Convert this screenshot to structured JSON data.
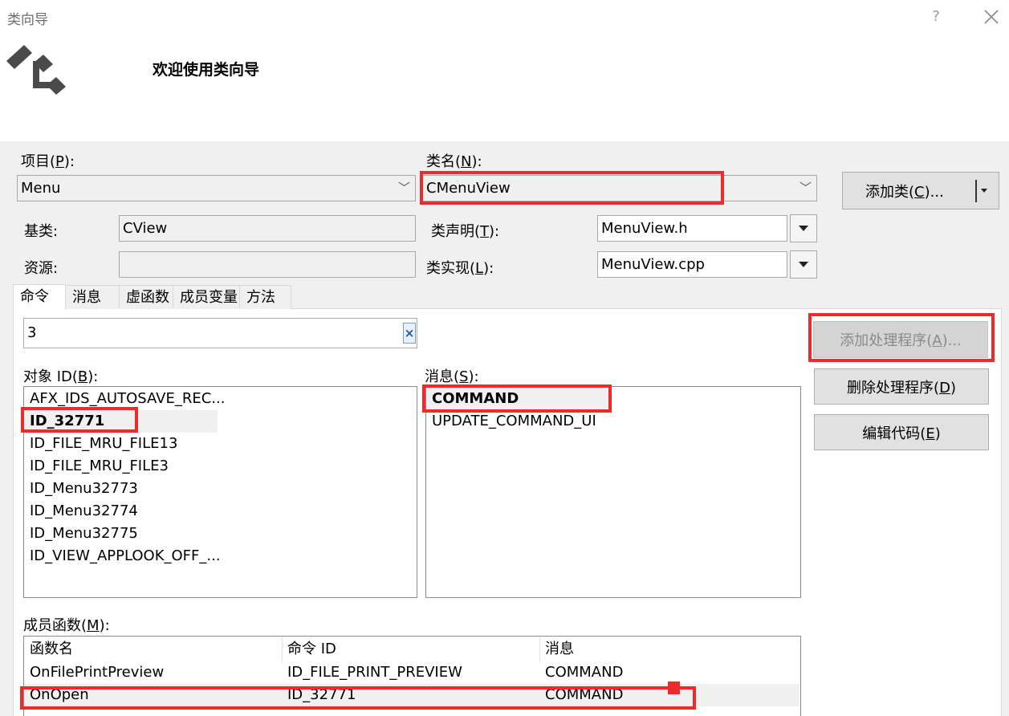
{
  "window": {
    "title": "类向导",
    "help_label": "?",
    "heading": "欢迎使用类向导"
  },
  "fields": {
    "project_label": "项目(",
    "project_key": "P",
    "project_value": "Menu",
    "classname_label": "类名(",
    "classname_key": "N",
    "classname_value": "CMenuView",
    "baseclass_label": "基类:",
    "baseclass_value": "CView",
    "resource_label": "资源:",
    "resource_value": "",
    "decl_label": "类声明(",
    "decl_key": "T",
    "decl_value": "MenuView.h",
    "impl_label": "类实现(",
    "impl_key": "L",
    "impl_value": "MenuView.cpp",
    "close_paren_colon": "):"
  },
  "buttons": {
    "add_class_pre": "添加类(",
    "add_class_key": "C",
    "add_class_post": ")...",
    "add_handler_pre": "添加处理程序(",
    "add_handler_key": "A",
    "add_handler_post": ")...",
    "delete_handler_pre": "删除处理程序(",
    "delete_handler_key": "D",
    "delete_handler_post": ")",
    "edit_code_pre": "编辑代码(",
    "edit_code_key": "E",
    "edit_code_post": ")"
  },
  "tabs": [
    "命令",
    "消息",
    "虚函数",
    "成员变量",
    "方法"
  ],
  "search": {
    "value": "3",
    "clear_label": "×"
  },
  "object_ids": {
    "label_pre": "对象 ID(",
    "label_key": "B",
    "label_post": "):",
    "items": [
      "AFX_IDS_AUTOSAVE_REC...",
      "ID_32771",
      "ID_FILE_MRU_FILE13",
      "ID_FILE_MRU_FILE3",
      "ID_Menu32773",
      "ID_Menu32774",
      "ID_Menu32775",
      "ID_VIEW_APPLOOK_OFF_..."
    ],
    "selected_index": 1
  },
  "messages": {
    "label_pre": "消息(",
    "label_key": "S",
    "label_post": "):",
    "items": [
      "COMMAND",
      "UPDATE_COMMAND_UI"
    ],
    "selected_index": 0
  },
  "members": {
    "label_pre": "成员函数(",
    "label_key": "M",
    "label_post": "):",
    "columns": [
      "函数名",
      "命令 ID",
      "消息"
    ],
    "rows": [
      [
        "OnFilePrintPreview",
        "ID_FILE_PRINT_PREVIEW",
        "COMMAND"
      ],
      [
        "OnOpen",
        "ID_32771",
        "COMMAND"
      ]
    ]
  },
  "colors": {
    "annotation_red": "#ec2b2b",
    "window_bg": "#f0f0f0"
  }
}
